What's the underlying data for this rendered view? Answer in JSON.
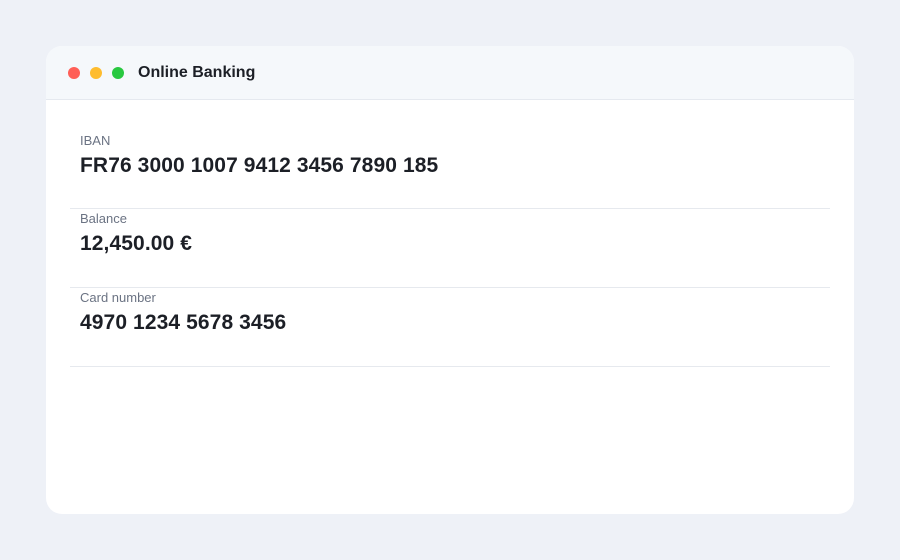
{
  "window": {
    "title": "Online Banking",
    "controls": [
      {
        "name": "close",
        "color": "#ff5f57"
      },
      {
        "name": "minimize",
        "color": "#febc2e"
      },
      {
        "name": "maximize",
        "color": "#28c840"
      }
    ]
  },
  "fields": [
    {
      "label": "IBAN",
      "value": "FR76 3000 1007 9412 3456 7890 185"
    },
    {
      "label": "Balance",
      "value": "12,450.00 €"
    },
    {
      "label": "Card number",
      "value": "4970 1234 5678 3456"
    }
  ]
}
